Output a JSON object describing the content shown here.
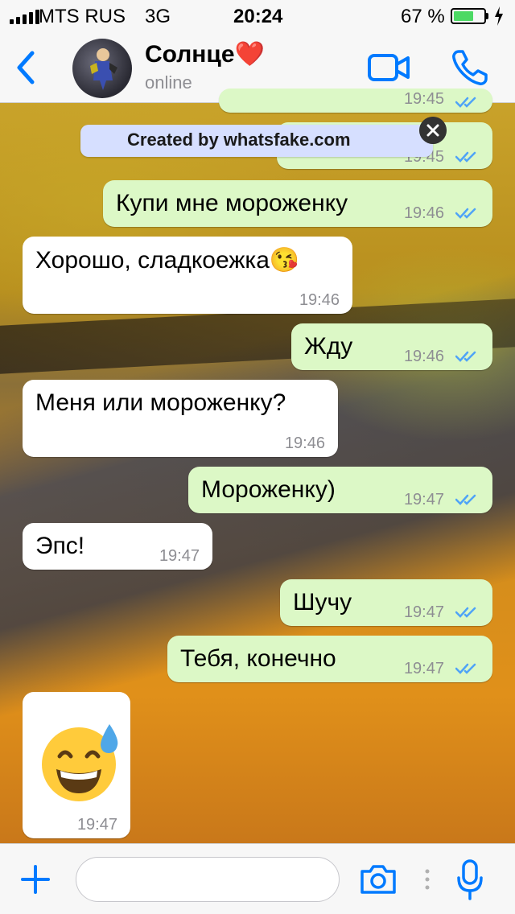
{
  "status_bar": {
    "carrier": "MTS RUS",
    "network": "3G",
    "time": "20:24",
    "battery": "67 %",
    "battery_level": 0.67,
    "battery_color": "#4cd964"
  },
  "header": {
    "contact_name": "Солнце❤️",
    "contact_status": "online",
    "accent_color": "#007aff"
  },
  "watermark": {
    "text": "Created by whatsfake.com"
  },
  "messages": [
    {
      "direction": "out",
      "text": "",
      "time": "19:45",
      "read": true
    },
    {
      "direction": "out",
      "text": "",
      "time": "19:45",
      "read": true
    },
    {
      "direction": "out",
      "text": "Купи мне мороженку",
      "time": "19:46",
      "read": true
    },
    {
      "direction": "in",
      "text": "Хорошо, сладкоежка😘",
      "time": "19:46"
    },
    {
      "direction": "out",
      "text": "Жду",
      "time": "19:46",
      "read": true
    },
    {
      "direction": "in",
      "text": "Меня или мороженку?",
      "time": "19:46"
    },
    {
      "direction": "out",
      "text": "Мороженку)",
      "time": "19:47",
      "read": true
    },
    {
      "direction": "in",
      "text": "Эпс!",
      "time": "19:47"
    },
    {
      "direction": "out",
      "text": "Шучу",
      "time": "19:47",
      "read": true
    },
    {
      "direction": "out",
      "text": "Тебя, конечно",
      "time": "19:47",
      "read": true
    },
    {
      "direction": "in",
      "text": "😅",
      "time": "19:47",
      "icon": "sweat-smile-emoji"
    }
  ],
  "input_bar": {
    "placeholder": "",
    "icons": [
      "plus-icon",
      "camera-icon",
      "microphone-icon"
    ]
  },
  "colors": {
    "outgoing_bubble": "#dcf8c6",
    "incoming_bubble": "#ffffff",
    "read_ticks": "#4fa3f7"
  }
}
